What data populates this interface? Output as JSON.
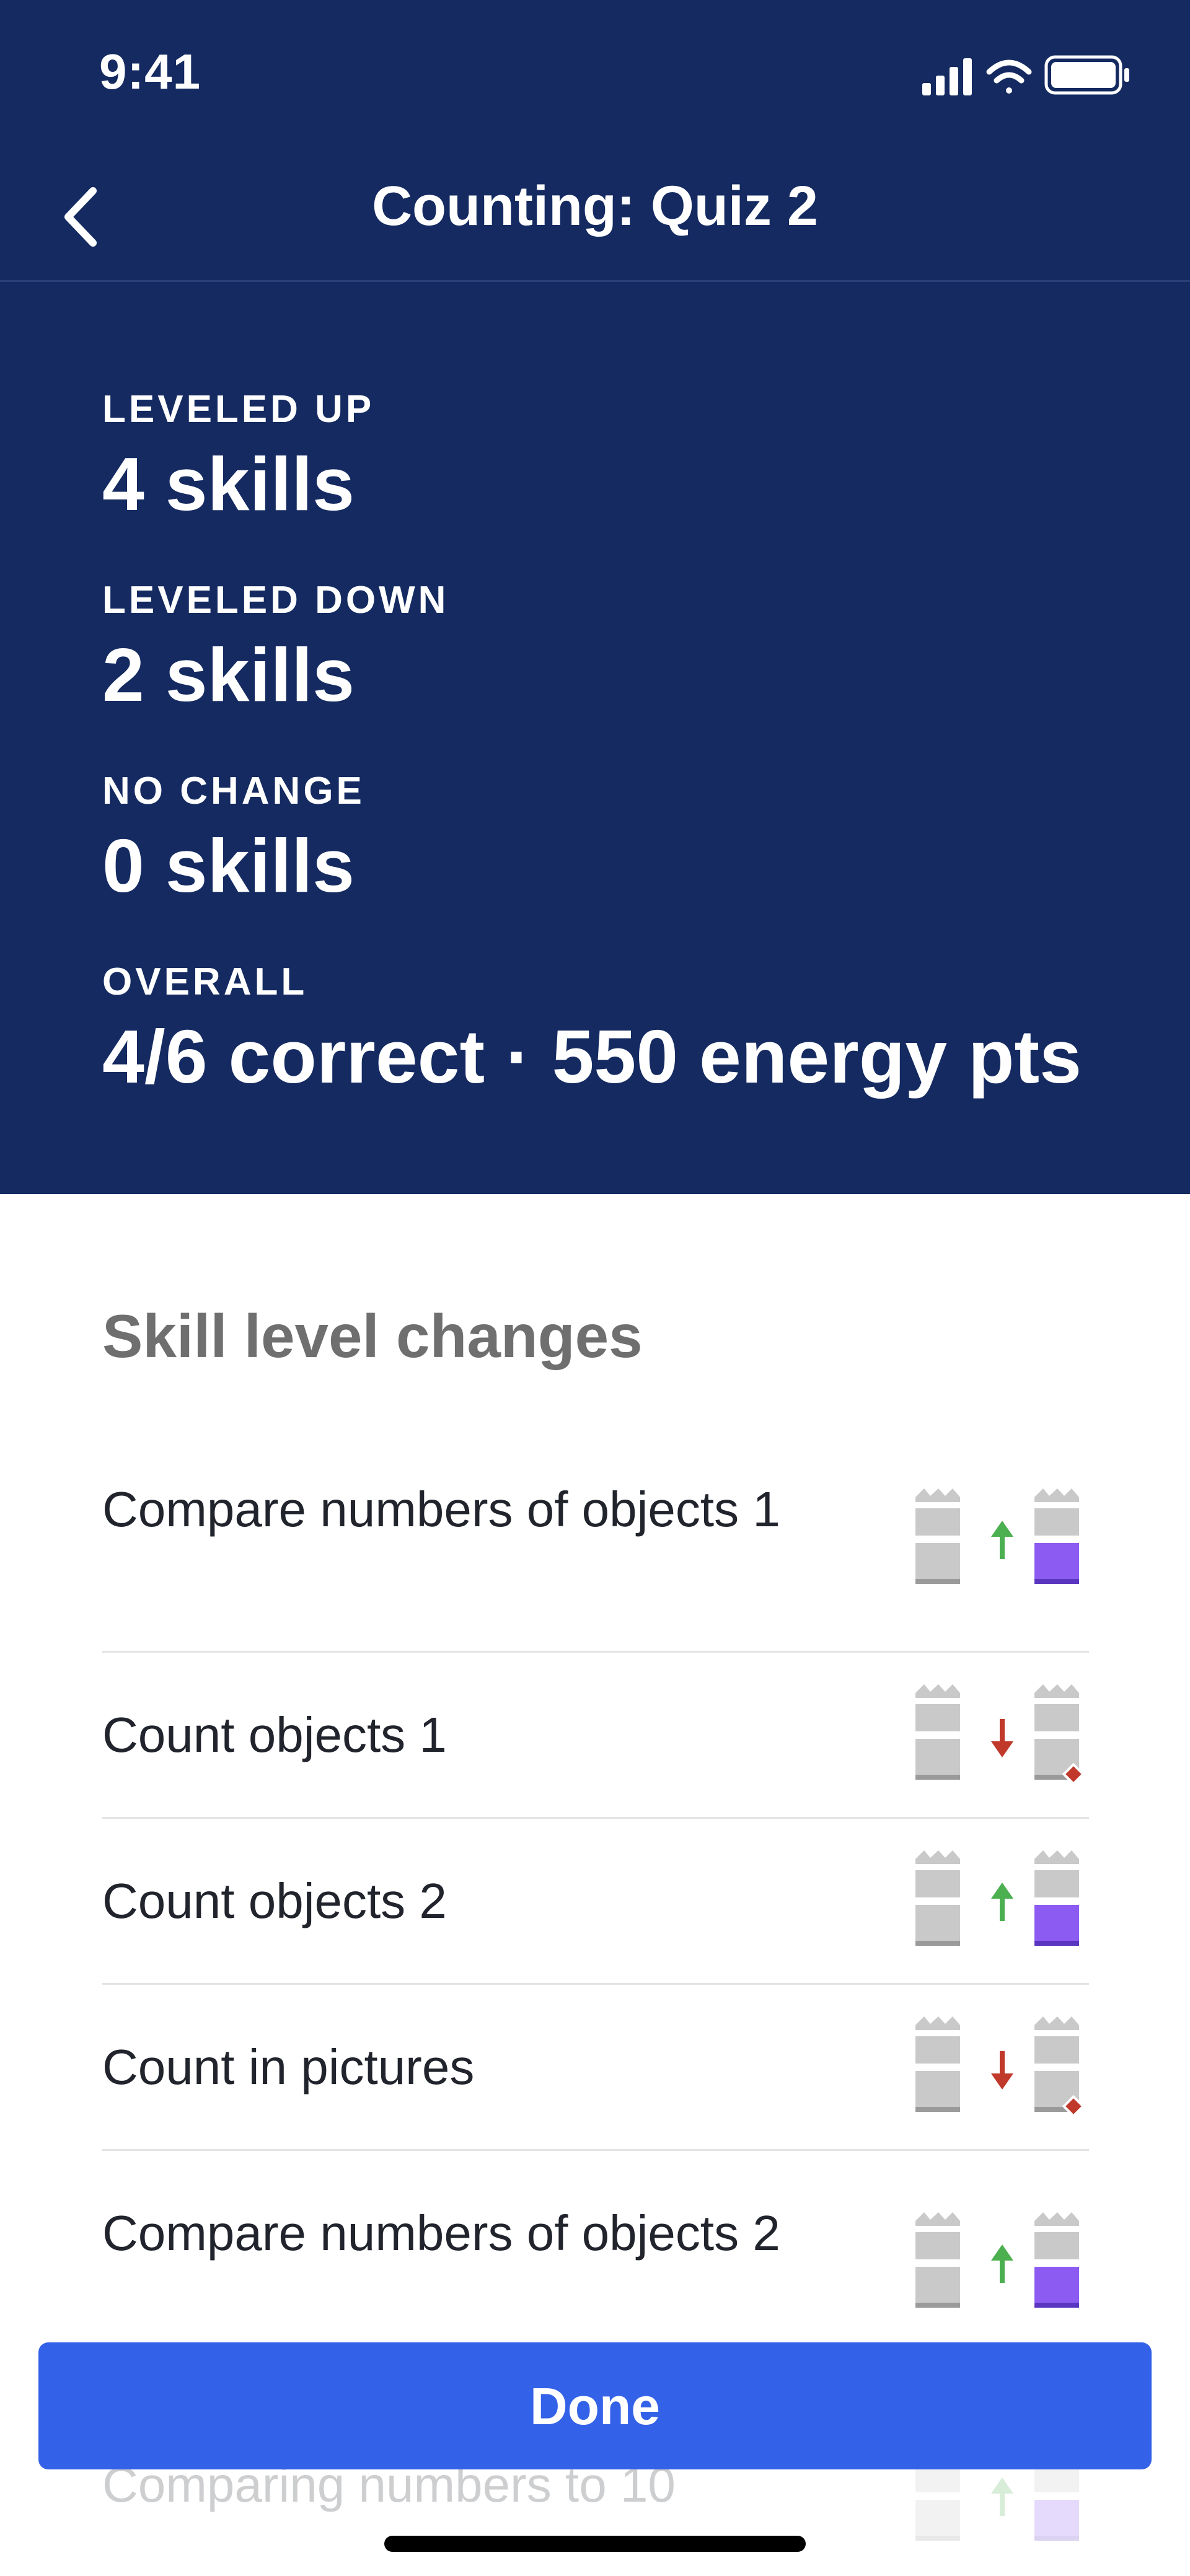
{
  "status_bar": {
    "time": "9:41"
  },
  "nav": {
    "title": "Counting: Quiz 2",
    "back_icon": "chevron-left-icon"
  },
  "summary": [
    {
      "label": "LEVELED UP",
      "value": "4 skills"
    },
    {
      "label": "LEVELED DOWN",
      "value": "2 skills"
    },
    {
      "label": "NO CHANGE",
      "value": "0 skills"
    },
    {
      "label": "OVERALL",
      "value": "4/6 correct · 550 energy pts"
    }
  ],
  "section_title": "Skill level changes",
  "skills": [
    {
      "name": "Compare numbers of objects 1",
      "change": "up"
    },
    {
      "name": "Count objects 1",
      "change": "down"
    },
    {
      "name": "Count objects 2",
      "change": "up"
    },
    {
      "name": "Count in pictures",
      "change": "down"
    },
    {
      "name": "Compare numbers of objects 2",
      "change": "up"
    },
    {
      "name": "Comparing numbers to 10",
      "change": "up"
    }
  ],
  "colors": {
    "header_bg": "#142a61",
    "primary": "#3362e8",
    "level_up": "#4caf50",
    "level_down": "#c0392b",
    "mastery": "#8c5cf2"
  },
  "done_label": "Done"
}
